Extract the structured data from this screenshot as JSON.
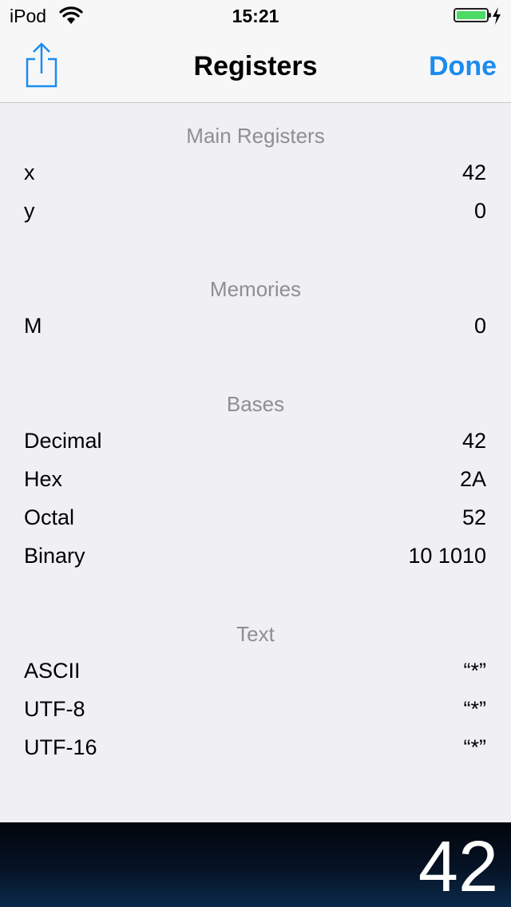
{
  "status_bar": {
    "carrier": "iPod",
    "time": "15:21",
    "battery_level": 1.0,
    "battery_color": "#4cd964",
    "charging": true,
    "icons": [
      "wifi-icon",
      "battery-icon",
      "charging-bolt-icon"
    ]
  },
  "nav": {
    "title": "Registers",
    "done_label": "Done",
    "share_icon": "share-icon",
    "accent_color": "#1a8cf0"
  },
  "sections": {
    "main": {
      "header": "Main Registers",
      "rows": [
        {
          "label": "x",
          "value": "42"
        },
        {
          "label": "y",
          "value": "0"
        }
      ]
    },
    "memories": {
      "header": "Memories",
      "rows": [
        {
          "label": "M",
          "value": "0"
        }
      ]
    },
    "bases": {
      "header": "Bases",
      "rows": [
        {
          "label": "Decimal",
          "value": "42"
        },
        {
          "label": "Hex",
          "value": "2A"
        },
        {
          "label": "Octal",
          "value": "52"
        },
        {
          "label": "Binary",
          "value": "10 1010"
        }
      ]
    },
    "text": {
      "header": "Text",
      "rows": [
        {
          "label": "ASCII",
          "value": "“*”"
        },
        {
          "label": "UTF-8",
          "value": "“*”"
        },
        {
          "label": "UTF-16",
          "value": "“*”"
        }
      ]
    }
  },
  "display": {
    "value": "42"
  }
}
